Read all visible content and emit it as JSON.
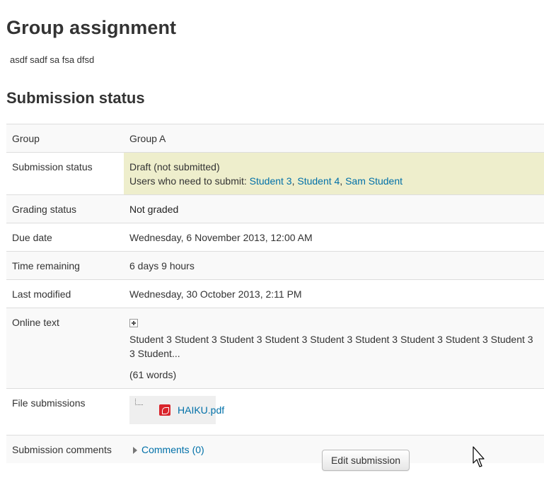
{
  "page": {
    "title": "Group assignment",
    "intro": "asdf sadf sa fsa dfsd"
  },
  "section": {
    "title": "Submission status"
  },
  "rows": {
    "group": {
      "label": "Group",
      "value": "Group A"
    },
    "submission_status": {
      "label": "Submission status",
      "value": "Draft (not submitted)",
      "users_prefix": "Users who need to submit: ",
      "users": [
        "Student 3",
        "Student 4",
        "Sam Student"
      ],
      "separator": ", "
    },
    "grading_status": {
      "label": "Grading status",
      "value": "Not graded"
    },
    "due_date": {
      "label": "Due date",
      "value": "Wednesday, 6 November 2013, 12:00 AM"
    },
    "time_remaining": {
      "label": "Time remaining",
      "value": "6 days 9 hours"
    },
    "last_modified": {
      "label": "Last modified",
      "value": "Wednesday, 30 October 2013, 2:11 PM"
    },
    "online_text": {
      "label": "Online text",
      "preview": "Student 3 Student 3 Student 3 Student 3 Student 3 Student 3 Student 3 Student 3 Student 3 3 Student...",
      "word_count": "(61 words)",
      "expand_icon": "plus-icon"
    },
    "file_submissions": {
      "label": "File submissions",
      "file_name": "HAIKU.pdf",
      "file_icon": "pdf-icon"
    },
    "submission_comments": {
      "label": "Submission comments",
      "link": "Comments (0)",
      "toggle_icon": "triangle-right-icon"
    }
  },
  "actions": {
    "edit_label": "Edit submission"
  },
  "colors": {
    "link": "#0070a8",
    "draft_highlight": "#eeeecc",
    "text": "#333333"
  }
}
